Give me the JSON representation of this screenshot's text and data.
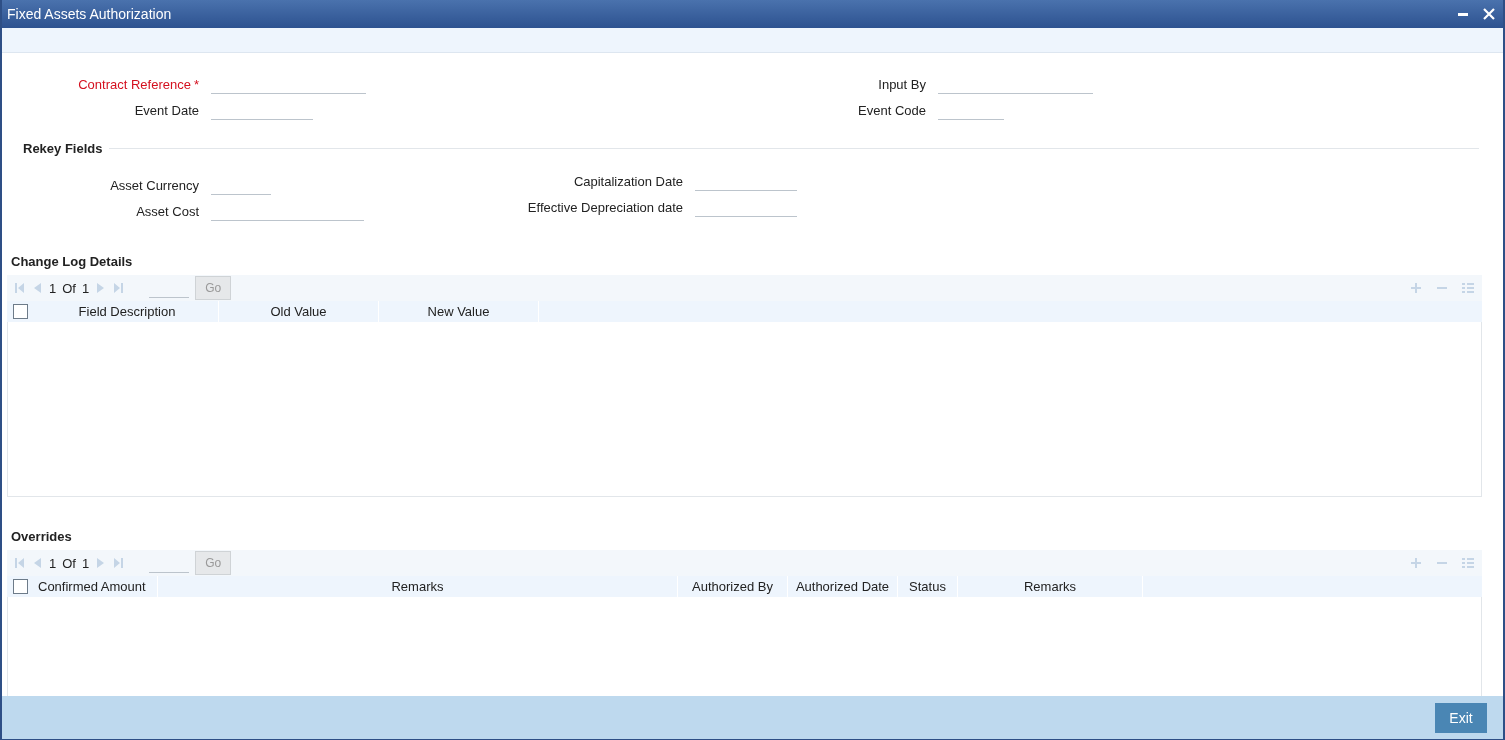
{
  "window": {
    "title": "Fixed Assets Authorization"
  },
  "header_fields": {
    "left": [
      {
        "label": "Contract Reference",
        "required_mark": "*"
      },
      {
        "label": "Event Date"
      }
    ],
    "right": [
      {
        "label": "Input By"
      },
      {
        "label": "Event Code"
      }
    ]
  },
  "rekey": {
    "title": "Rekey Fields",
    "left": [
      {
        "label": "Asset Currency"
      },
      {
        "label": "Asset Cost"
      }
    ],
    "right": [
      {
        "label": "Capitalization Date"
      },
      {
        "label": "Effective Depreciation date"
      }
    ]
  },
  "grids": [
    {
      "title": "Change Log Details",
      "pager": {
        "current": "1",
        "of": "Of",
        "total": "1",
        "go": "Go"
      },
      "select_all_checked": false,
      "columns": [
        "Field Description",
        "Old Value",
        "New Value"
      ]
    },
    {
      "title": "Overrides",
      "pager": {
        "current": "1",
        "of": "Of",
        "total": "1",
        "go": "Go"
      },
      "select_all_checked": false,
      "columns": [
        "Confirmed Amount",
        "Remarks",
        "Authorized By",
        "Authorized Date",
        "Status",
        "Remarks"
      ]
    }
  ],
  "footer": {
    "exit": "Exit"
  }
}
